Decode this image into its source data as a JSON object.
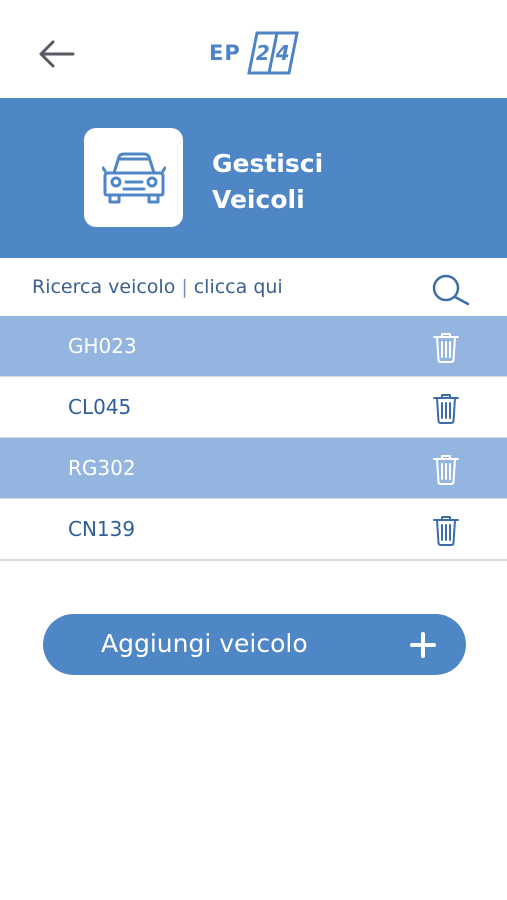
{
  "topbar": {
    "back_icon": "arrow-left-icon",
    "logo": {
      "prefix": "EP",
      "digit_1": "2",
      "digit_2": "4"
    }
  },
  "header": {
    "icon": "car-icon",
    "title_line1": "Gestisci",
    "title_line2": "Veicoli",
    "background": "#4f86c6"
  },
  "search": {
    "label": "Ricerca veicolo",
    "separator": "|",
    "hint": "clicca qui",
    "icon": "search-icon"
  },
  "vehicles": [
    {
      "plate": "GH023",
      "delete_icon": "trash-icon"
    },
    {
      "plate": "CL045",
      "delete_icon": "trash-icon"
    },
    {
      "plate": "RG302",
      "delete_icon": "trash-icon"
    },
    {
      "plate": "CN139",
      "delete_icon": "trash-icon"
    }
  ],
  "add_button": {
    "label": "Aggiungi veicolo",
    "icon": "plus-icon"
  },
  "colors": {
    "primary": "#4f86c6",
    "row_highlight": "#94b5df",
    "text_primary": "#2f5e9a"
  }
}
